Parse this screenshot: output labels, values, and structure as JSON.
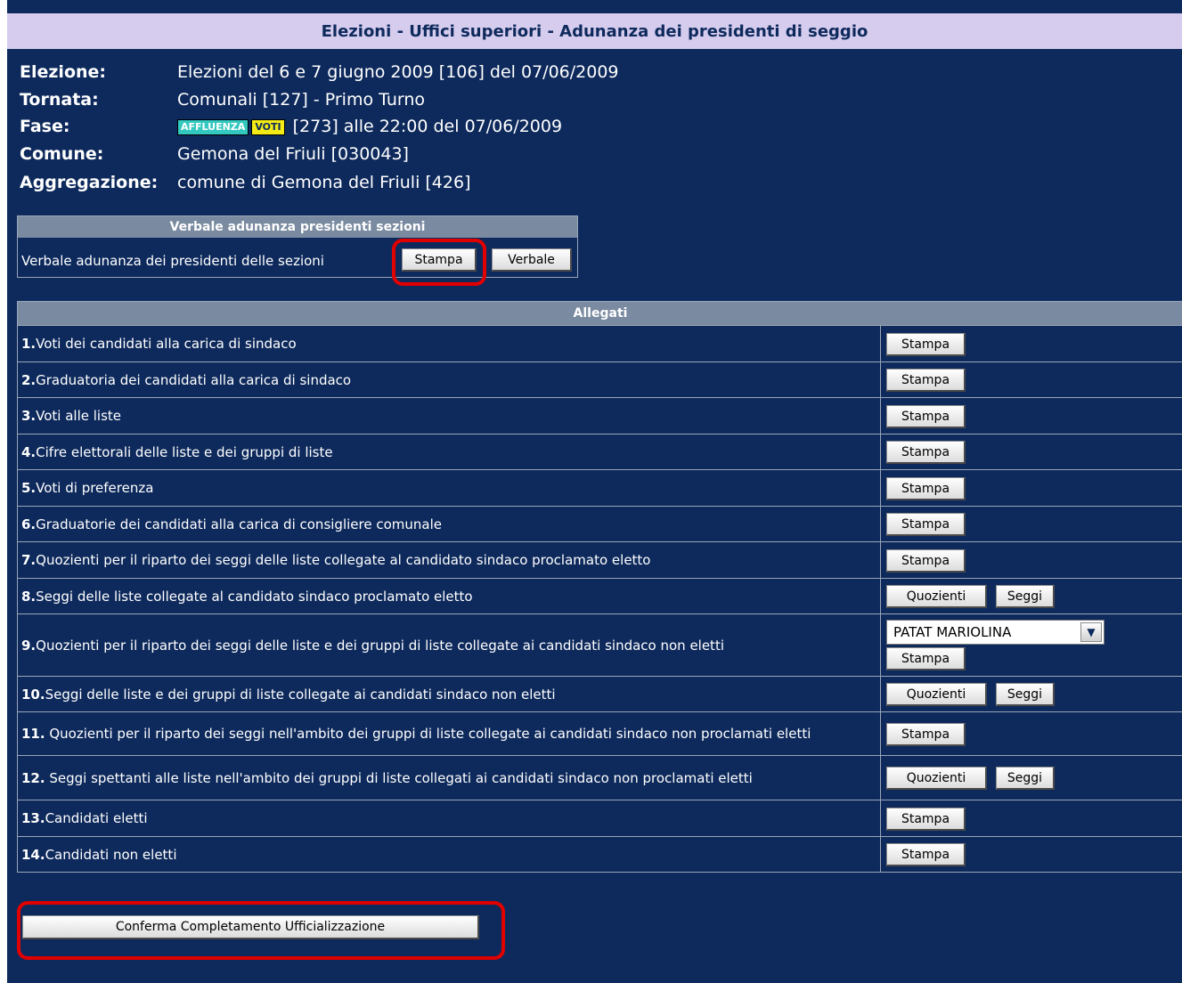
{
  "header": {
    "title": "Elezioni - Uffici superiori - Adunanza dei presidenti di seggio"
  },
  "info": {
    "elezione_label": "Elezione:",
    "elezione_value": "Elezioni del 6 e 7 giugno 2009 [106] del 07/06/2009",
    "tornata_label": "Tornata:",
    "tornata_value": "Comunali [127] - Primo Turno",
    "fase_label": "Fase:",
    "fase_badge_affluenza": "AFFLUENZA",
    "fase_badge_voti": "VOTI",
    "fase_value": "[273] alle 22:00 del 07/06/2009",
    "comune_label": "Comune:",
    "comune_value": "Gemona del Friuli [030043]",
    "aggregazione_label": "Aggregazione:",
    "aggregazione_value": "comune di Gemona del Friuli [426]"
  },
  "verbale": {
    "header": "Verbale adunanza presidenti sezioni",
    "label": "Verbale adunanza dei presidenti delle sezioni",
    "stampa_label": "Stampa",
    "verbale_label": "Verbale"
  },
  "allegati": {
    "header": "Allegati",
    "stampa_label": "Stampa",
    "quozienti_label": "Quozienti",
    "seggi_label": "Seggi",
    "candidate_select_value": "PATAT MARIOLINA",
    "rows": [
      {
        "num": "1.",
        "text": " Voti dei candidati alla carica di sindaco"
      },
      {
        "num": "2.",
        "text": " Graduatoria dei candidati alla carica di sindaco"
      },
      {
        "num": "3.",
        "text": " Voti alle liste"
      },
      {
        "num": "4.",
        "text": " Cifre elettorali delle liste e dei gruppi di liste"
      },
      {
        "num": "5.",
        "text": " Voti di preferenza"
      },
      {
        "num": "6.",
        "text": " Graduatorie dei candidati alla carica di consigliere comunale"
      },
      {
        "num": "7.",
        "text": " Quozienti per il riparto dei seggi delle liste collegate al candidato sindaco proclamato eletto"
      },
      {
        "num": "8.",
        "text": " Seggi delle liste collegate al candidato sindaco proclamato eletto"
      },
      {
        "num": "9.",
        "text": " Quozienti per il riparto dei seggi delle liste e dei gruppi di liste collegate ai candidati sindaco non eletti"
      },
      {
        "num": "10.",
        "text": " Seggi delle liste e dei gruppi di liste collegate ai candidati sindaco non eletti"
      },
      {
        "num": "11.",
        "text": " Quozienti per il riparto dei seggi nell'ambito dei gruppi di liste collegate ai candidati sindaco non proclamati eletti"
      },
      {
        "num": "12.",
        "text": " Seggi spettanti alle liste nell'ambito dei gruppi di liste collegati ai candidati sindaco non proclamati eletti"
      },
      {
        "num": "13.",
        "text": " Candidati eletti"
      },
      {
        "num": "14.",
        "text": " Candidati non eletti"
      }
    ]
  },
  "footer": {
    "confirm_label": "Conferma Completamento Ufficializzazione"
  },
  "colors": {
    "background": "#0e2a5c",
    "title_bar": "#d6ccee",
    "table_header": "#7a8aa0",
    "highlight_ring": "#e10000"
  }
}
